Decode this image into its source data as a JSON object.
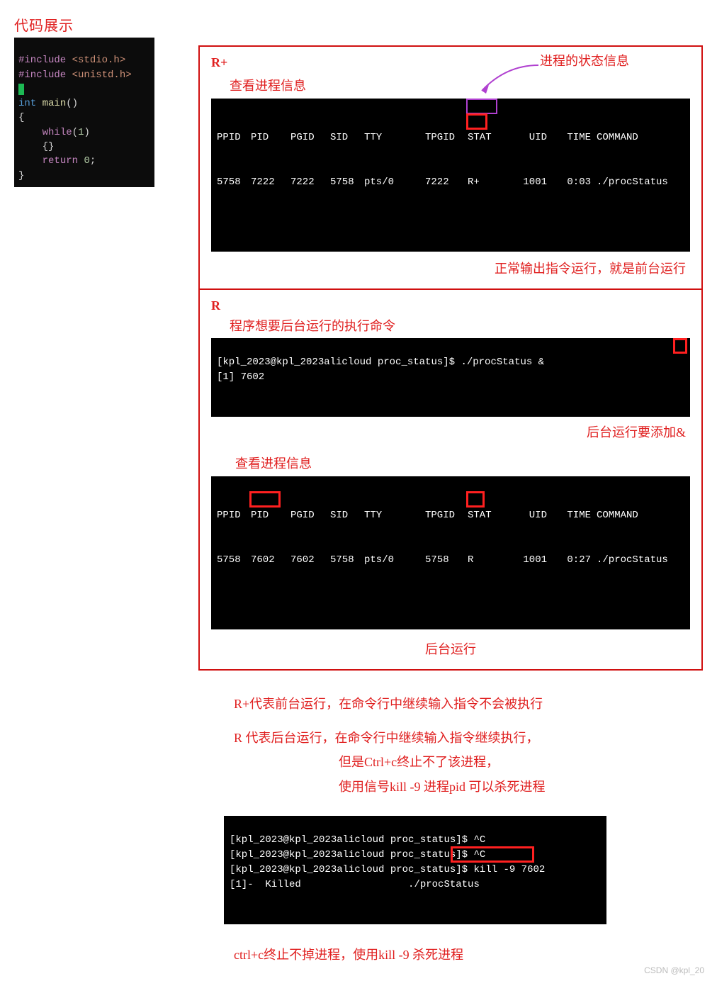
{
  "code_title": "代码展示",
  "code": {
    "l1a": "#include ",
    "l1b": "<stdio.h>",
    "l2a": "#include ",
    "l2b": "<unistd.h>",
    "cursor": " ",
    "l4a": "int",
    "l4b": " ",
    "l4c": "main",
    "l4d": "()",
    "l5": "{",
    "l6a": "    ",
    "l6b": "while",
    "l6c": "(",
    "l6d": "1",
    "l6e": ")",
    "l7": "    {}",
    "l8a": "    ",
    "l8b": "return",
    "l8c": " ",
    "l8d": "0",
    "l8e": ";",
    "l9": "}"
  },
  "p1": {
    "tag": "R+",
    "status_label": "进程的状态信息",
    "view_label": "查看进程信息",
    "hdr": {
      "ppid": "PPID",
      "pid": "PID",
      "pgid": "PGID",
      "sid": "SID",
      "tty": "TTY",
      "tpgid": "TPGID",
      "stat": "STAT",
      "uid": "UID",
      "time": "TIME",
      "cmd": "COMMAND"
    },
    "row": {
      "ppid": "5758",
      "pid": "7222",
      "pgid": "7222",
      "sid": "5758",
      "tty": "pts/0",
      "tpgid": "7222",
      "stat": "R+",
      "uid": "1001",
      "time": "0:03",
      "cmd": "./procStatus"
    },
    "note": "正常输出指令运行，就是前台运行"
  },
  "p2": {
    "tag": "R",
    "cmd_label": "程序想要后台运行的执行命令",
    "term1_l1": "[kpl_2023@kpl_2023alicloud proc_status]$ ./procStatus &",
    "term1_l2": "[1] 7602",
    "note1": "后台运行要添加&",
    "view_label": "查看进程信息",
    "hdr": {
      "ppid": "PPID",
      "pid": "PID",
      "pgid": "PGID",
      "sid": "SID",
      "tty": "TTY",
      "tpgid": "TPGID",
      "stat": "STAT",
      "uid": "UID",
      "time": "TIME",
      "cmd": "COMMAND"
    },
    "row": {
      "ppid": "5758",
      "pid": "7602",
      "pgid": "7602",
      "sid": "5758",
      "tty": "pts/0",
      "tpgid": "5758",
      "stat": "R",
      "uid": "1001",
      "time": "0:27",
      "cmd": "./procStatus"
    },
    "note2": "后台运行"
  },
  "notes": {
    "n1": "R+代表前台运行，在命令行中继续输入指令不会被执行",
    "n2": "R 代表后台运行，在命令行中继续输入指令继续执行，",
    "n3": "但是Ctrl+c终止不了该进程，",
    "n4": "使用信号kill -9 进程pid 可以杀死进程"
  },
  "term3": {
    "l1": "[kpl_2023@kpl_2023alicloud proc_status]$ ^C",
    "l2": "[kpl_2023@kpl_2023alicloud proc_status]$ ^C",
    "l3": "[kpl_2023@kpl_2023alicloud proc_status]$ kill -9 7602",
    "l4": "[1]-  Killed                  ./procStatus"
  },
  "final_note": "ctrl+c终止不掉进程，使用kill -9 杀死进程",
  "watermark": "CSDN @kpl_20"
}
